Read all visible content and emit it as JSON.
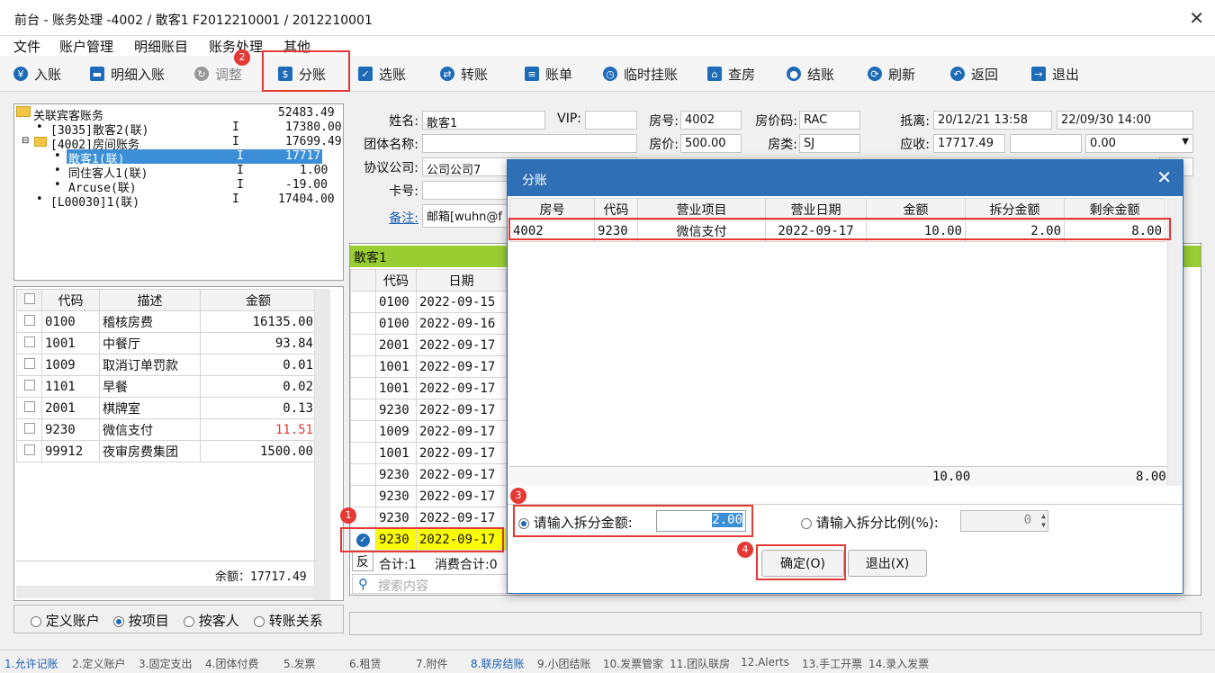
{
  "window": {
    "title": "前台 - 账务处理 -4002 / 散客1 F2012210001 / 2012210001",
    "close": "✕"
  },
  "menu": [
    "文件",
    "账户管理",
    "明细账目",
    "账务处理",
    "其他"
  ],
  "toolbar": [
    {
      "label": "入账",
      "icon": "yen-icon"
    },
    {
      "label": "明细入账",
      "icon": "ledger-icon"
    },
    {
      "label": "调整",
      "icon": "adjust-icon"
    },
    {
      "label": "分账",
      "icon": "split-icon"
    },
    {
      "label": "选账",
      "icon": "select-icon"
    },
    {
      "label": "转账",
      "icon": "transfer-icon"
    },
    {
      "label": "账单",
      "icon": "bill-icon"
    },
    {
      "label": "临时挂账",
      "icon": "clock-icon"
    },
    {
      "label": "查房",
      "icon": "house-search-icon"
    },
    {
      "label": "结账",
      "icon": "coins-icon"
    },
    {
      "label": "刷新",
      "icon": "refresh-icon"
    },
    {
      "label": "返回",
      "icon": "back-icon"
    },
    {
      "label": "退出",
      "icon": "exit-icon"
    }
  ],
  "badges": [
    "1",
    "2",
    "3",
    "4"
  ],
  "tree": {
    "root": {
      "name": "关联宾客账务",
      "amount": "52483.49"
    },
    "items": [
      {
        "name": "[3035]散客2(联)",
        "flag": "I",
        "amount": "17380.00"
      },
      {
        "name": "[4002]房间账务",
        "flag": "I",
        "amount": "17699.49"
      },
      {
        "name": "散客1(联)",
        "flag": "I",
        "amount": "17717.49"
      },
      {
        "name": "同住客人1(联)",
        "flag": "I",
        "amount": "1.00"
      },
      {
        "name": "Arcuse(联)",
        "flag": "I",
        "amount": "-19.00"
      },
      {
        "name": "[L00030]1(联)",
        "flag": "I",
        "amount": "17404.00"
      }
    ]
  },
  "summary": {
    "headers": [
      "代码",
      "描述",
      "金额"
    ],
    "rows": [
      [
        "0100",
        "稽核房费",
        "16135.00"
      ],
      [
        "1001",
        "中餐厅",
        "93.84"
      ],
      [
        "1009",
        "取消订单罚款",
        "0.01"
      ],
      [
        "1101",
        "早餐",
        "0.02"
      ],
      [
        "2001",
        "棋牌室",
        "0.13"
      ],
      [
        "9230",
        "微信支付",
        "11.51"
      ],
      [
        "99912",
        "夜审房费集团",
        "1500.00"
      ]
    ],
    "balance": "余额：17717.49"
  },
  "view_modes": [
    "定义账户",
    "按项目",
    "按客人",
    "转账关系"
  ],
  "guest": {
    "name_label": "姓名:",
    "name": "散客1",
    "vip_label": "VIP:",
    "vip": "",
    "room_label": "房号:",
    "room": "4002",
    "rate_code_label": "房价码:",
    "rate_code": "RAC",
    "arrive_label": "抵离:",
    "arrive": "20/12/21 13:58",
    "depart": "22/09/30 14:00",
    "group_label": "团体名称:",
    "group": "",
    "price_label": "房价:",
    "price": "500.00",
    "type_label": "房类:",
    "type": "SJ",
    "receivable_label": "应收:",
    "receivable": "17717.49",
    "receivable2": "",
    "discount": "0.00",
    "company_label": "协议公司:",
    "company": "公司公司7",
    "card_label": "卡号:",
    "card": "",
    "note_label": "备注:",
    "note": "邮箱[wuhn@f"
  },
  "detail": {
    "title": "散客1",
    "headers": [
      "代码",
      "日期"
    ],
    "rows": [
      [
        "0100",
        "2022-09-15"
      ],
      [
        "0100",
        "2022-09-16"
      ],
      [
        "2001",
        "2022-09-17"
      ],
      [
        "1001",
        "2022-09-17"
      ],
      [
        "1001",
        "2022-09-17"
      ],
      [
        "9230",
        "2022-09-17"
      ],
      [
        "1009",
        "2022-09-17"
      ],
      [
        "1001",
        "2022-09-17"
      ],
      [
        "9230",
        "2022-09-17"
      ],
      [
        "9230",
        "2022-09-17"
      ],
      [
        "9230",
        "2022-09-17"
      ],
      [
        "9230",
        "2022-09-17"
      ]
    ],
    "reverse": "反",
    "total": "合计:1",
    "consume_total": "消费合计:0",
    "search_placeholder": "搜索内容"
  },
  "dialog": {
    "title": "分账",
    "close": "✕",
    "headers": [
      "房号",
      "代码",
      "营业项目",
      "营业日期",
      "金额",
      "拆分金额",
      "剩余金额"
    ],
    "row": [
      "4002",
      "9230",
      "微信支付",
      "2022-09-17",
      "10.00",
      "2.00",
      "8.00"
    ],
    "footer_amount": "10.00",
    "footer_remain": "8.00",
    "amount_label": "请输入拆分金额:",
    "amount_value": "2.00",
    "ratio_label": "请输入拆分比例(%):",
    "ratio_value": "0",
    "ok": "确定(O)",
    "cancel": "退出(X)"
  },
  "status_tabs": [
    "1.允许记账",
    "2.定义账户",
    "3.固定支出",
    "4.团体付费",
    "5.发票",
    "6.租赁",
    "7.附件",
    "8.联房结账",
    "9.小团结账",
    "10.发票管家",
    "11.团队联房",
    "12.Alerts",
    "13.手工开票",
    "14.录入发票"
  ],
  "colors": {
    "accent": "#2f6fb5",
    "highlight": "#ffff00",
    "green": "#9acd32",
    "red": "#e53935"
  }
}
